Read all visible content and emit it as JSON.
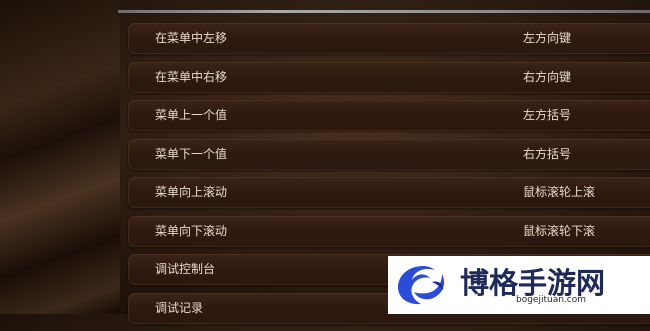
{
  "keybindings": [
    {
      "action": "在菜单中左移",
      "key": "左方向键"
    },
    {
      "action": "在菜单中右移",
      "key": "右方向键"
    },
    {
      "action": "菜单上一个值",
      "key": "左方括号"
    },
    {
      "action": "菜单下一个值",
      "key": "右方括号"
    },
    {
      "action": "菜单向上滚动",
      "key": "鼠标滚轮上滚"
    },
    {
      "action": "菜单向下滚动",
      "key": "鼠标滚轮下滚"
    },
    {
      "action": "调试控制台",
      "key": ""
    },
    {
      "action": "调试记录",
      "key": ""
    }
  ],
  "watermark": {
    "title": "博格手游网",
    "url": "bogejituan.com",
    "logo_icon": "swirl-logo-icon",
    "colors": {
      "blue": "#2b4bd8",
      "text": "#1f2a5a"
    }
  }
}
